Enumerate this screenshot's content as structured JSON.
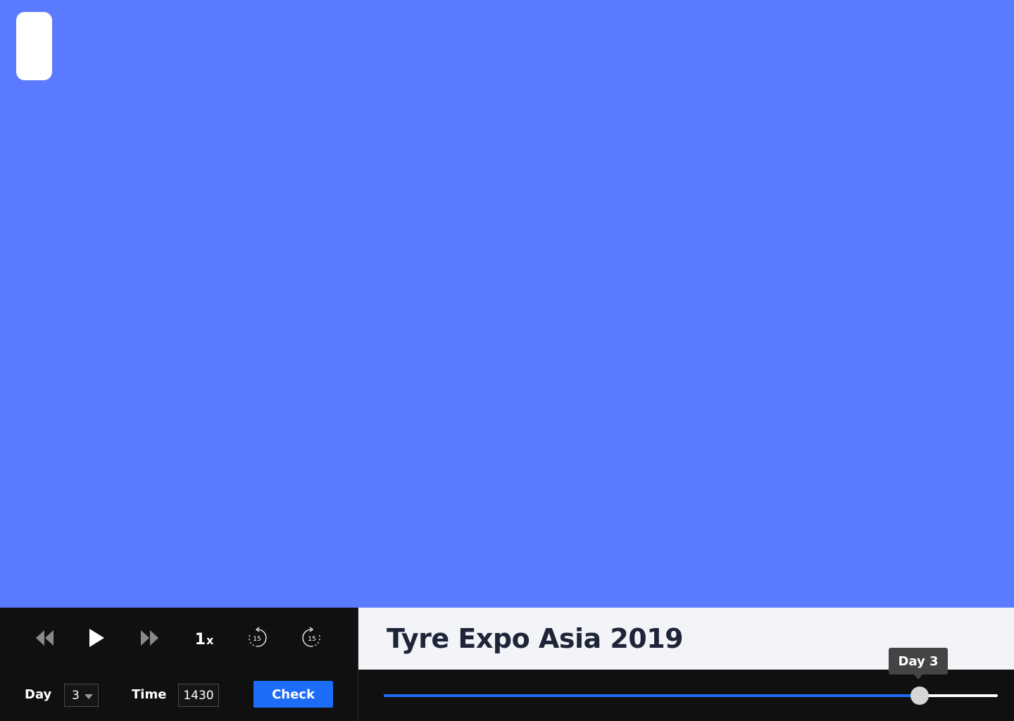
{
  "icons": {
    "rewind": "rewind-icon",
    "play": "play-icon",
    "fast_forward": "fast-forward-icon",
    "skip_back": "replay-15-icon",
    "skip_forward": "forward-15-icon",
    "dropdown": "chevron-down-icon"
  },
  "controls": {
    "speed_value": "1",
    "speed_unit": "x",
    "skip_back_seconds": "15",
    "skip_forward_seconds": "15"
  },
  "filters": {
    "day_label": "Day",
    "day_value": "3",
    "time_label": "Time",
    "time_value": "1430",
    "check_label": "Check"
  },
  "event": {
    "title": "Tyre Expo Asia 2019"
  },
  "timeline": {
    "tooltip": "Day 3",
    "progress": 0.873
  },
  "colors": {
    "stage_background": "#5a7bff",
    "accent": "#1c6cf7",
    "panel_background": "#101010",
    "title_background": "#f3f4f8"
  }
}
